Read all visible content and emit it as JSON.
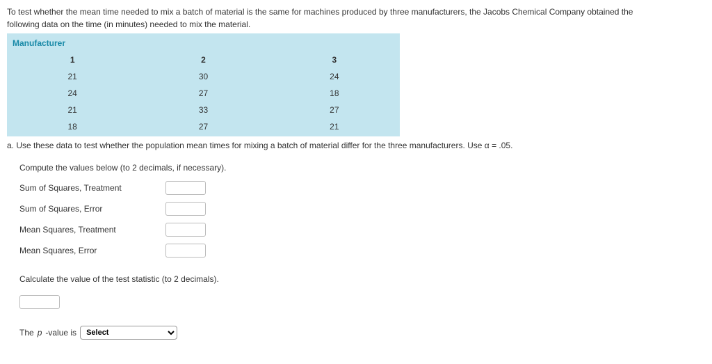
{
  "intro": {
    "line1": "To test whether the mean time needed to mix a batch of material is the same for machines produced by three manufacturers, the Jacobs Chemical Company obtained the",
    "line2": "following data on the time (in minutes) needed to mix the material."
  },
  "table": {
    "title": "Manufacturer",
    "headers": {
      "c1": "1",
      "c2": "2",
      "c3": "3"
    },
    "rows": [
      {
        "c1": "21",
        "c2": "30",
        "c3": "24"
      },
      {
        "c1": "24",
        "c2": "27",
        "c3": "18"
      },
      {
        "c1": "21",
        "c2": "33",
        "c3": "27"
      },
      {
        "c1": "18",
        "c2": "27",
        "c3": "21"
      }
    ]
  },
  "partA": {
    "prompt": "a. Use these data to test whether the population mean times for mixing a batch of material differ for the three manufacturers. Use α = .05.",
    "computeHint": "Compute the values below (to 2 decimals, if necessary).",
    "fields": {
      "ssTreatment": "Sum of Squares, Treatment",
      "ssError": "Sum of Squares, Error",
      "msTreatment": "Mean Squares, Treatment",
      "msError": "Mean Squares, Error"
    },
    "testStatPrompt": "Calculate the value of the test statistic (to 2 decimals).",
    "pValuePrefix": "The ",
    "pValueItalic": "p",
    "pValueSuffix": "-value is",
    "selectPlaceholder": "Select"
  }
}
